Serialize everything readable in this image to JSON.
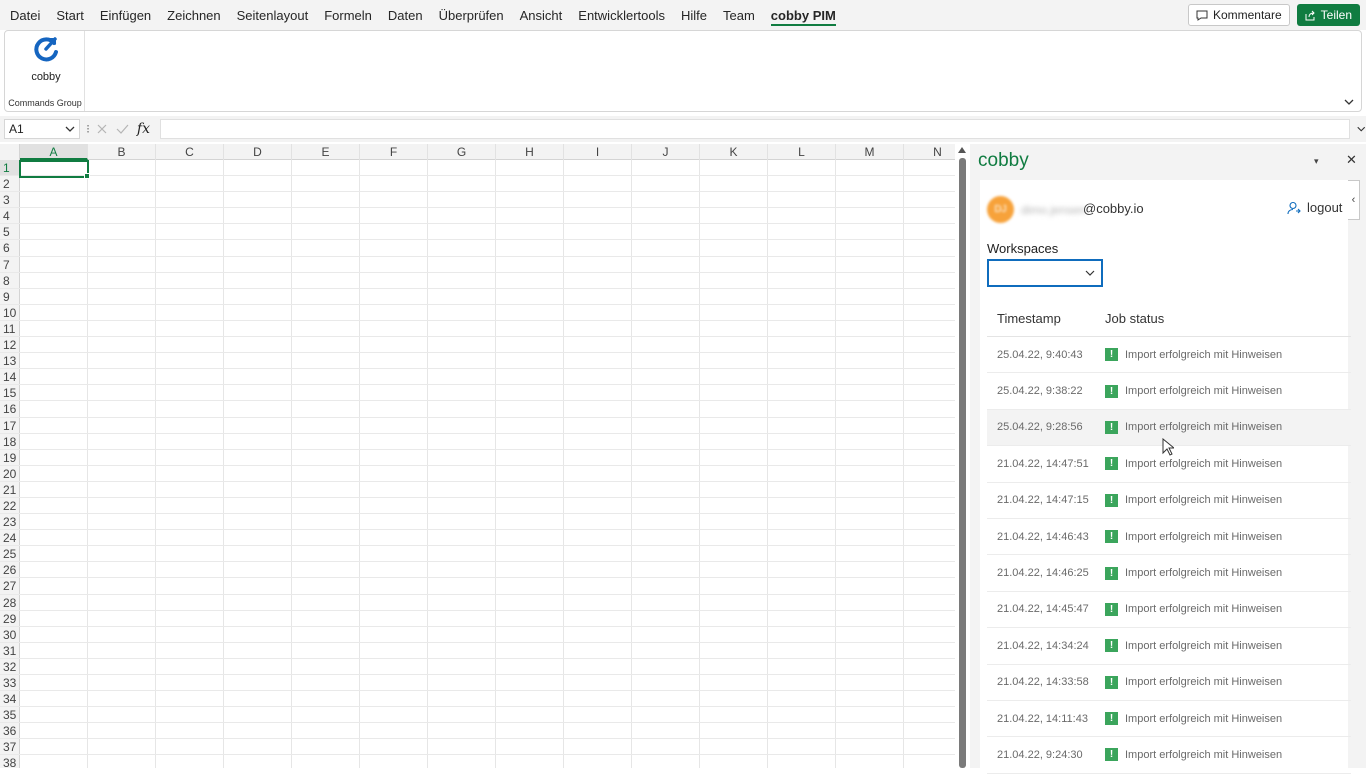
{
  "menubar": {
    "items": [
      "Datei",
      "Start",
      "Einfügen",
      "Zeichnen",
      "Seitenlayout",
      "Formeln",
      "Daten",
      "Überprüfen",
      "Ansicht",
      "Entwicklertools",
      "Hilfe",
      "Team",
      "cobby PIM"
    ],
    "active_item": "cobby PIM",
    "comments_label": "Kommentare",
    "share_label": "Teilen"
  },
  "ribbon": {
    "cobby_button_label": "cobby",
    "group_label": "Commands Group"
  },
  "formula_bar": {
    "name_box": "A1",
    "separator": "⁝",
    "fx_label": "fx",
    "value": ""
  },
  "grid": {
    "columns": [
      "A",
      "B",
      "C",
      "D",
      "E",
      "F",
      "G",
      "H",
      "I",
      "J",
      "K",
      "L",
      "M",
      "N"
    ],
    "rows": [
      "1",
      "2",
      "3",
      "4",
      "5",
      "6",
      "7",
      "8",
      "9",
      "10",
      "11",
      "12",
      "13",
      "14",
      "15",
      "16",
      "17",
      "18",
      "19",
      "20",
      "21",
      "22",
      "23",
      "24",
      "25",
      "26",
      "27",
      "28",
      "29",
      "30",
      "31",
      "32",
      "33",
      "34",
      "35",
      "36",
      "37",
      "38"
    ],
    "selected_cell": "A1"
  },
  "pane": {
    "title": "cobby",
    "user": {
      "avatar_initials": "DJ",
      "masked_name": "dimo.jensen",
      "email_domain": "@cobby.io",
      "logout_label": "logout"
    },
    "workspaces_label": "Workspaces",
    "workspace_selected": "",
    "table": {
      "headers": [
        "Timestamp",
        "Job status"
      ],
      "rows": [
        {
          "timestamp": "25.04.22, 9:40:43",
          "status": "Import erfolgreich mit Hinweisen"
        },
        {
          "timestamp": "25.04.22, 9:38:22",
          "status": "Import erfolgreich mit Hinweisen"
        },
        {
          "timestamp": "25.04.22, 9:28:56",
          "status": "Import erfolgreich mit Hinweisen"
        },
        {
          "timestamp": "21.04.22, 14:47:51",
          "status": "Import erfolgreich mit Hinweisen"
        },
        {
          "timestamp": "21.04.22, 14:47:15",
          "status": "Import erfolgreich mit Hinweisen"
        },
        {
          "timestamp": "21.04.22, 14:46:43",
          "status": "Import erfolgreich mit Hinweisen"
        },
        {
          "timestamp": "21.04.22, 14:46:25",
          "status": "Import erfolgreich mit Hinweisen"
        },
        {
          "timestamp": "21.04.22, 14:45:47",
          "status": "Import erfolgreich mit Hinweisen"
        },
        {
          "timestamp": "21.04.22, 14:34:24",
          "status": "Import erfolgreich mit Hinweisen"
        },
        {
          "timestamp": "21.04.22, 14:33:58",
          "status": "Import erfolgreich mit Hinweisen"
        },
        {
          "timestamp": "21.04.22, 14:11:43",
          "status": "Import erfolgreich mit Hinweisen"
        },
        {
          "timestamp": "21.04.22, 9:24:30",
          "status": "Import erfolgreich mit Hinweisen"
        }
      ],
      "hovered_row": 3
    },
    "status_icon": "warning-icon",
    "accent_color": "#107c41"
  }
}
